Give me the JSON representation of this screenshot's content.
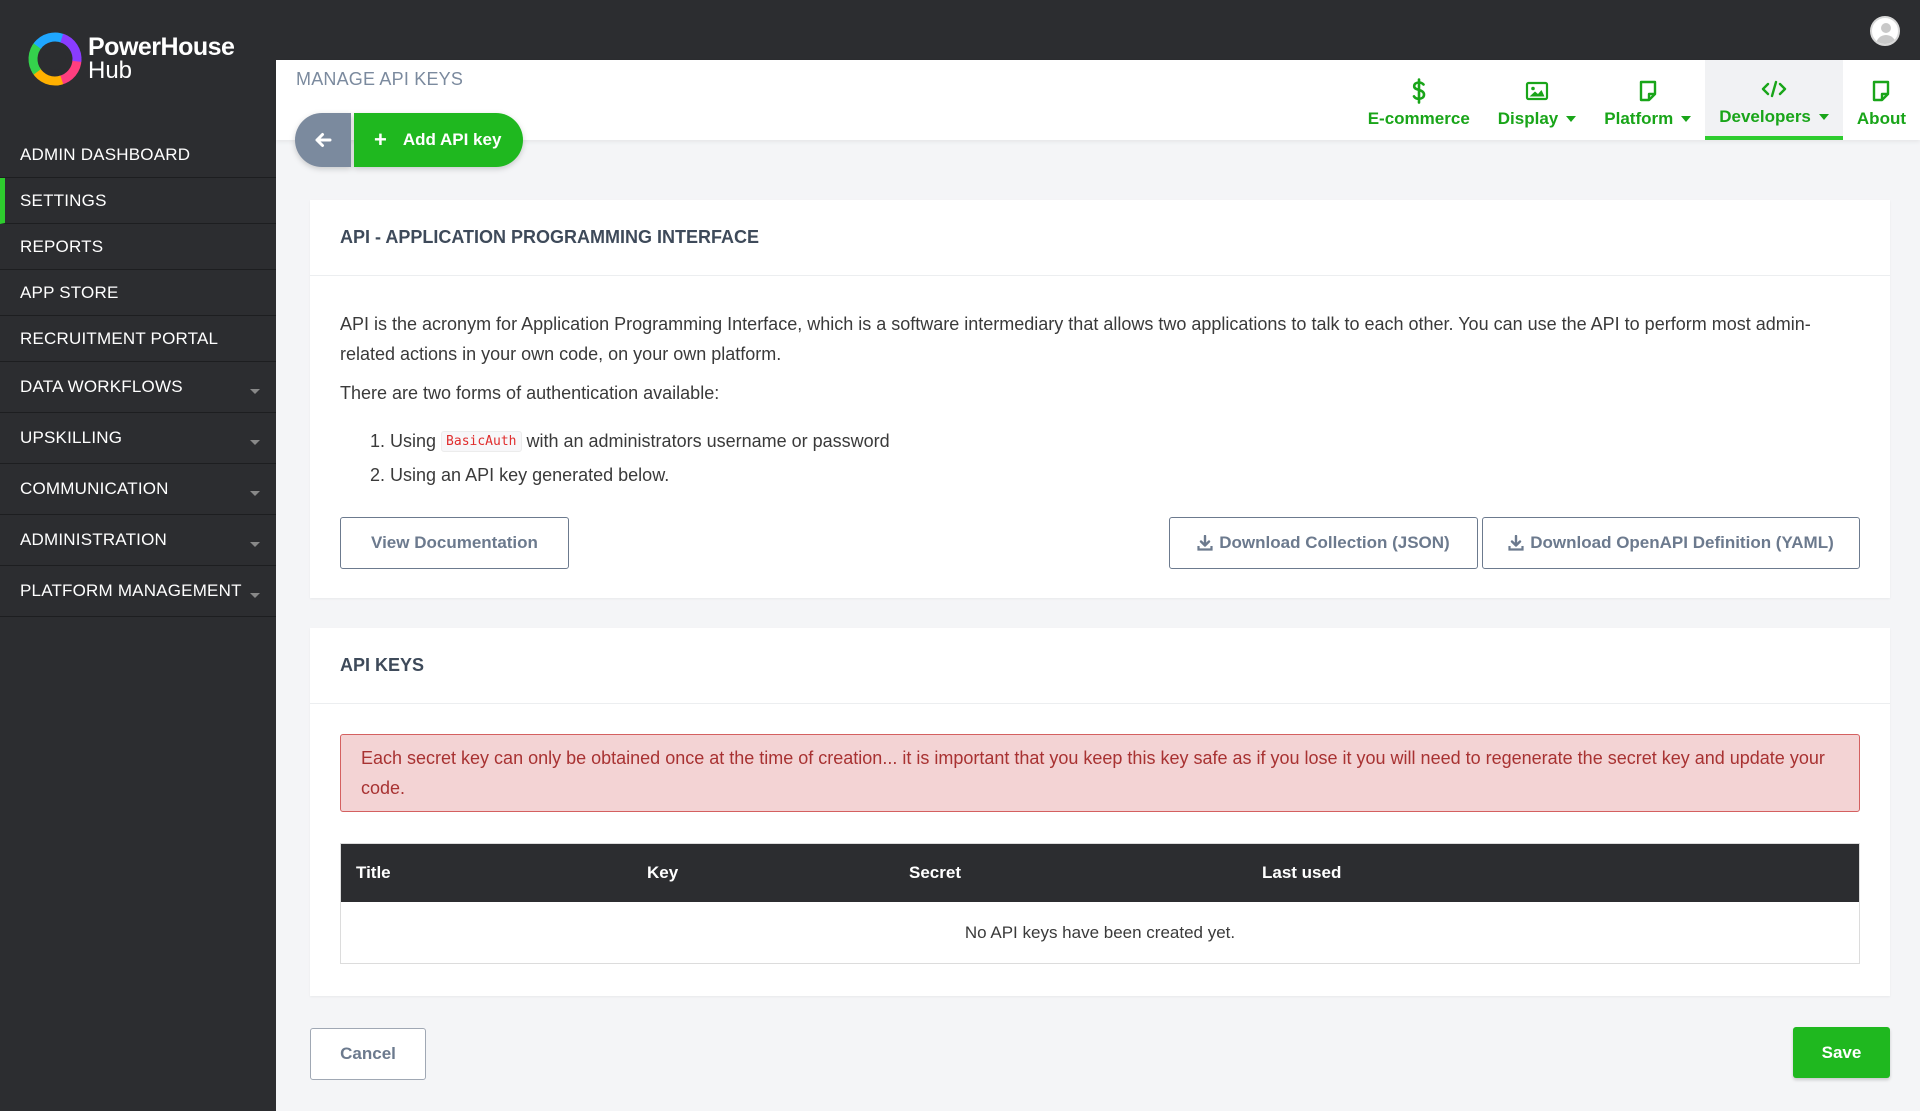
{
  "brand": {
    "name_line1": "PowerHouse",
    "name_line2": "Hub"
  },
  "sidebar": {
    "items": [
      {
        "label": "ADMIN DASHBOARD",
        "active": false,
        "has_caret": false
      },
      {
        "label": "SETTINGS",
        "active": true,
        "has_caret": false
      },
      {
        "label": "REPORTS",
        "active": false,
        "has_caret": false
      },
      {
        "label": "APP STORE",
        "active": false,
        "has_caret": false
      },
      {
        "label": "RECRUITMENT PORTAL",
        "active": false,
        "has_caret": false
      },
      {
        "label": "DATA WORKFLOWS",
        "active": false,
        "has_caret": true
      },
      {
        "label": "UPSKILLING",
        "active": false,
        "has_caret": true
      },
      {
        "label": "COMMUNICATION",
        "active": false,
        "has_caret": true
      },
      {
        "label": "ADMINISTRATION",
        "active": false,
        "has_caret": true
      },
      {
        "label": "PLATFORM MANAGEMENT",
        "active": false,
        "has_caret": true
      }
    ]
  },
  "header": {
    "page_title": "MANAGE API KEYS",
    "add_button_label": "Add API key",
    "tabs": [
      {
        "label": "E-commerce",
        "icon": "dollar-icon",
        "dropdown": false,
        "active": false
      },
      {
        "label": "Display",
        "icon": "image-icon",
        "dropdown": true,
        "active": false
      },
      {
        "label": "Platform",
        "icon": "sticky-note-icon",
        "dropdown": true,
        "active": false
      },
      {
        "label": "Developers",
        "icon": "code-icon",
        "dropdown": true,
        "active": true
      },
      {
        "label": "About",
        "icon": "sticky-note-icon",
        "dropdown": false,
        "active": false
      }
    ]
  },
  "api_panel": {
    "title": "API - APPLICATION PROGRAMMING INTERFACE",
    "intro": "API is the acronym for Application Programming Interface, which is a software intermediary that allows two applications to talk to each other. You can use the API to perform most admin-related actions in your own code, on your own platform.",
    "auth_intro": "There are two forms of authentication available:",
    "auth_item1_prefix": "1. Using",
    "auth_item1_code": "BasicAuth",
    "auth_item1_suffix": "with an administrators username or password",
    "auth_item2": "2. Using an API key generated below.",
    "view_docs_label": "View Documentation",
    "download_json_label": "Download Collection (JSON)",
    "download_yaml_label": "Download OpenAPI Definition (YAML)"
  },
  "keys_panel": {
    "title": "API KEYS",
    "alert": "Each secret key can only be obtained once at the time of creation... it is important that you keep this key safe as if you lose it you will need to regenerate the secret key and update your code.",
    "columns": [
      "Title",
      "Key",
      "Secret",
      "Last used"
    ],
    "empty_message": "No API keys have been created yet."
  },
  "footer": {
    "cancel_label": "Cancel",
    "save_label": "Save"
  },
  "colors": {
    "sidebar_bg": "#2c2d30",
    "accent_green": "#1fb81f",
    "tab_green": "#19a519",
    "muted_blue": "#7b8a9e",
    "alert_bg": "#f3d3d4",
    "alert_text": "#a83232"
  }
}
